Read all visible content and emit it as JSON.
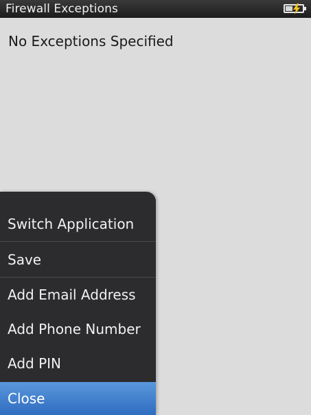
{
  "title_bar": {
    "title": "Firewall Exceptions",
    "battery_icon": "battery-charging-icon"
  },
  "main": {
    "message": "No Exceptions Specified"
  },
  "menu": {
    "items": [
      {
        "label": "Switch Application"
      },
      {
        "label": "Save"
      },
      {
        "label": "Add Email Address"
      },
      {
        "label": "Add Phone Number"
      },
      {
        "label": "Add PIN"
      },
      {
        "label": "Close",
        "selected": true
      }
    ],
    "selected_color": "#3b7ad0",
    "background_color": "#2c2c2e"
  }
}
